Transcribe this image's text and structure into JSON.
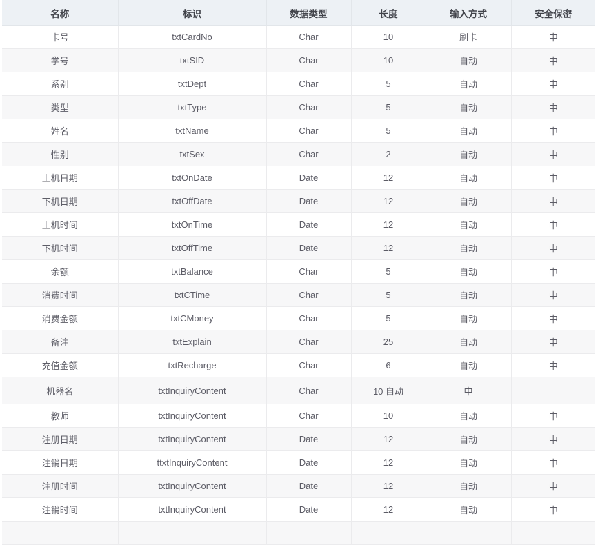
{
  "table": {
    "columns": [
      {
        "key": "name",
        "label": "名称"
      },
      {
        "key": "identifier",
        "label": "标识"
      },
      {
        "key": "datatype",
        "label": "数据类型"
      },
      {
        "key": "length",
        "label": "长度"
      },
      {
        "key": "input",
        "label": "输入方式"
      },
      {
        "key": "security",
        "label": "安全保密"
      }
    ],
    "rows": [
      {
        "name": "卡号",
        "identifier": "txtCardNo",
        "datatype": "Char",
        "length": "10",
        "input": "刷卡",
        "security": "中"
      },
      {
        "name": "学号",
        "identifier": "txtSID",
        "datatype": "Char",
        "length": "10",
        "input": "自动",
        "security": "中"
      },
      {
        "name": "系别",
        "identifier": "txtDept",
        "datatype": "Char",
        "length": "5",
        "input": "自动",
        "security": "中"
      },
      {
        "name": "类型",
        "identifier": "txtType",
        "datatype": "Char",
        "length": "5",
        "input": "自动",
        "security": "中"
      },
      {
        "name": "姓名",
        "identifier": "txtName",
        "datatype": "Char",
        "length": "5",
        "input": "自动",
        "security": "中"
      },
      {
        "name": "性别",
        "identifier": "txtSex",
        "datatype": "Char",
        "length": "2",
        "input": "自动",
        "security": "中"
      },
      {
        "name": "上机日期",
        "identifier": "txtOnDate",
        "datatype": "Date",
        "length": "12",
        "input": "自动",
        "security": "中"
      },
      {
        "name": "下机日期",
        "identifier": "txtOffDate",
        "datatype": "Date",
        "length": "12",
        "input": "自动",
        "security": "中"
      },
      {
        "name": "上机时间",
        "identifier": "txtOnTime",
        "datatype": "Date",
        "length": "12",
        "input": "自动",
        "security": "中"
      },
      {
        "name": "下机时间",
        "identifier": "txtOffTime",
        "datatype": "Date",
        "length": "12",
        "input": "自动",
        "security": "中"
      },
      {
        "name": "余额",
        "identifier": "txtBalance",
        "datatype": "Char",
        "length": "5",
        "input": "自动",
        "security": "中"
      },
      {
        "name": "消费时间",
        "identifier": "txtCTime",
        "datatype": "Char",
        "length": "5",
        "input": "自动",
        "security": "中"
      },
      {
        "name": "消费金额",
        "identifier": "txtCMoney",
        "datatype": "Char",
        "length": "5",
        "input": "自动",
        "security": "中"
      },
      {
        "name": "备注",
        "identifier": "txtExplain",
        "datatype": "Char",
        "length": "25",
        "input": "自动",
        "security": "中"
      },
      {
        "name": "充值金额",
        "identifier": "txtRecharge",
        "datatype": "Char",
        "length": "6",
        "input": "自动",
        "security": "中"
      },
      {
        "name": "机器名",
        "identifier": "txtInquiryContent",
        "datatype": "Char",
        "length": "10 自动",
        "input": "中",
        "security": "",
        "tall": true
      },
      {
        "name": "教师",
        "identifier": "txtInquiryContent",
        "datatype": "Char",
        "length": "10",
        "input": "自动",
        "security": "中"
      },
      {
        "name": "注册日期",
        "identifier": "txtInquiryContent",
        "datatype": "Date",
        "length": "12",
        "input": "自动",
        "security": "中"
      },
      {
        "name": "注销日期",
        "identifier": "ttxtInquiryContent",
        "datatype": "Date",
        "length": "12",
        "input": "自动",
        "security": "中"
      },
      {
        "name": "注册时间",
        "identifier": "txtInquiryContent",
        "datatype": "Date",
        "length": "12",
        "input": "自动",
        "security": "中"
      },
      {
        "name": "注销时间",
        "identifier": "txtInquiryContent",
        "datatype": "Date",
        "length": "12",
        "input": "自动",
        "security": "中"
      },
      {
        "name": "",
        "identifier": "",
        "datatype": "",
        "length": "",
        "input": "",
        "security": ""
      }
    ]
  },
  "colors": {
    "header_background": "#edf1f5",
    "header_text": "#41434a",
    "row_text": "#5c5c66",
    "row_odd_background": "#ffffff",
    "row_even_background": "#f7f7f8",
    "border": "#ebebed"
  }
}
